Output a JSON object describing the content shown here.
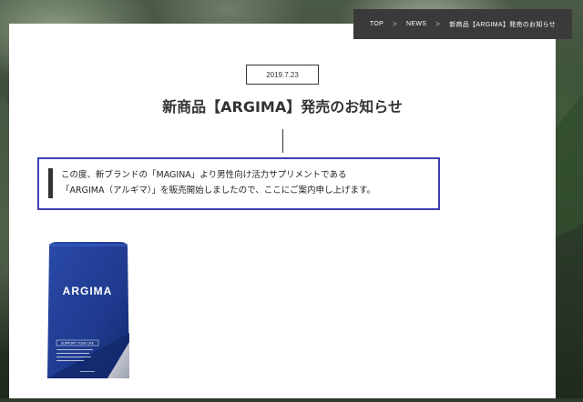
{
  "breadcrumb": {
    "items": [
      "TOP",
      "NEWS",
      "新商品【ARGIMA】発売のお知らせ"
    ],
    "separator": ">"
  },
  "article": {
    "date": "2019.7.23",
    "title": "新商品【ARGIMA】発売のお知らせ",
    "lead_lines": [
      "この度、新ブランドの「MAGINA」より男性向け活力サプリメントである",
      "「ARGIMA（アルギマ）」を販売開始しましたので、ここにご案内申し上げます。"
    ]
  },
  "product": {
    "brand": "ARGIMA",
    "tagline": "SUPPORT YOUR LIFE",
    "colors": {
      "pack": "#1f3a8f",
      "pack_dark": "#142a6e",
      "accent": "#3b3fb0"
    }
  }
}
